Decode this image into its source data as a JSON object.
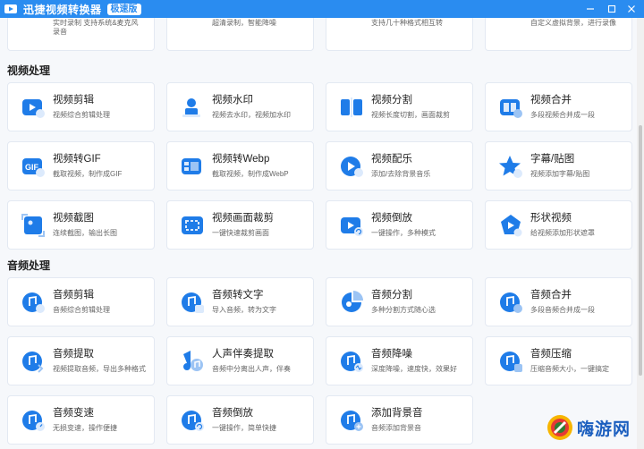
{
  "window": {
    "title": "迅捷视频转换器",
    "edition": "极速版"
  },
  "top_partial": [
    {
      "desc": "实时录制 支持系统&麦克风",
      "desc2": "录音",
      "icon": "screen-record-icon"
    },
    {
      "desc": "超清录制，智能降噪",
      "icon": "hd-record-icon"
    },
    {
      "desc": "支持几十种格式相互转",
      "icon": "format-convert-icon"
    },
    {
      "desc": "自定义虚拟背景，进行录像",
      "icon": "virtual-background-icon"
    }
  ],
  "video_section": {
    "title": "视频处理",
    "items": [
      {
        "title": "视频剪辑",
        "desc": "视频综合剪辑处理",
        "icon": "video-edit-icon"
      },
      {
        "title": "视频水印",
        "desc": "视频去水印，视频加水印",
        "icon": "video-watermark-icon"
      },
      {
        "title": "视频分割",
        "desc": "视频长度切割，画面裁剪",
        "icon": "video-split-icon"
      },
      {
        "title": "视频合并",
        "desc": "多段视频合并成一段",
        "icon": "video-merge-icon"
      },
      {
        "title": "视频转GIF",
        "desc": "截取视频，制作成GIF",
        "icon": "video-to-gif-icon"
      },
      {
        "title": "视频转Webp",
        "desc": "截取视频，制作成WebP",
        "icon": "video-to-webp-icon"
      },
      {
        "title": "视频配乐",
        "desc": "添加/去除背景音乐",
        "icon": "video-music-icon"
      },
      {
        "title": "字幕/贴图",
        "desc": "视频添加字幕/贴图",
        "icon": "subtitle-sticker-icon"
      },
      {
        "title": "视频截图",
        "desc": "连续截图，输出长图",
        "icon": "video-screenshot-icon"
      },
      {
        "title": "视频画面裁剪",
        "desc": "一键快速裁剪画面",
        "icon": "video-crop-icon"
      },
      {
        "title": "视频倒放",
        "desc": "一键操作，多种模式",
        "icon": "video-reverse-icon"
      },
      {
        "title": "形状视频",
        "desc": "给视频添加形状遮罩",
        "icon": "shape-video-icon"
      }
    ]
  },
  "audio_section": {
    "title": "音频处理",
    "items": [
      {
        "title": "音频剪辑",
        "desc": "音频综合剪辑处理",
        "icon": "audio-edit-icon"
      },
      {
        "title": "音频转文字",
        "desc": "导入音频，转为文字",
        "icon": "audio-to-text-icon"
      },
      {
        "title": "音频分割",
        "desc": "多种分割方式随心选",
        "icon": "audio-split-icon"
      },
      {
        "title": "音频合并",
        "desc": "多段音频合并成一段",
        "icon": "audio-merge-icon"
      },
      {
        "title": "音频提取",
        "desc": "视频提取音频，导出多种格式",
        "icon": "audio-extract-icon"
      },
      {
        "title": "人声伴奏提取",
        "desc": "音频中分离出人声，伴奏",
        "icon": "vocal-separate-icon"
      },
      {
        "title": "音频降噪",
        "desc": "深度降噪，速度快，效果好",
        "icon": "audio-denoise-icon"
      },
      {
        "title": "音频压缩",
        "desc": "压缩音频大小，一键搞定",
        "icon": "audio-compress-icon"
      },
      {
        "title": "音频变速",
        "desc": "无损变速，操作便捷",
        "icon": "audio-speed-icon"
      },
      {
        "title": "音频倒放",
        "desc": "一键操作，简单快捷",
        "icon": "audio-reverse-icon"
      },
      {
        "title": "添加背景音",
        "desc": "音频添加背景音",
        "icon": "add-background-sound-icon"
      }
    ]
  },
  "watermark": {
    "text": "嗨游网"
  },
  "colors": {
    "accent": "#2a8cf0",
    "icon_blue": "#1f7ce8",
    "icon_light": "#dceafc"
  }
}
